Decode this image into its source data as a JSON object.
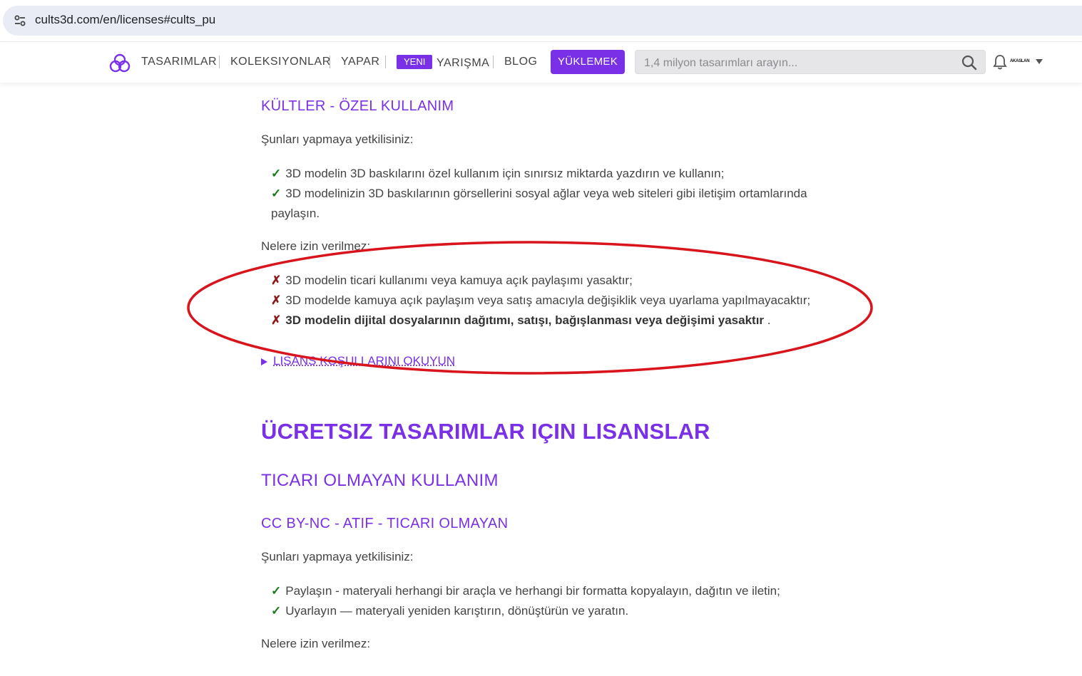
{
  "browser": {
    "url": "cults3d.com/en/licenses#cults_pu",
    "site_info_icon": "tune-icon"
  },
  "header": {
    "nav": [
      "TASARIMLAR",
      "KOLEKSIYONLAR",
      "YAPAR",
      "YARIŞMA",
      "BLOG"
    ],
    "new_badge": "YENI",
    "upload_label": "YÜKLEMEK",
    "search_placeholder": "1,4 milyon tasarımları arayın...",
    "avatar_text": "AKASLAN"
  },
  "content": {
    "section1": {
      "title": "KÜLTLER - ÖZEL KULLANIM",
      "allowed_intro": "Şunları yapmaya yetkilisiniz:",
      "allowed": [
        "3D modelin 3D baskılarını özel kullanım için sınırsız miktarda yazdırın ve kullanın;",
        "3D modelinizin 3D baskılarının görsellerini sosyal ağlar veya web siteleri gibi iletişim ortamlarında paylaşın."
      ],
      "forbidden_intro": "Nelere izin verilmez:",
      "forbidden": [
        "3D modelin ticari kullanımı veya kamuya açık paylaşımı yasaktır;",
        "3D modelde kamuya açık paylaşım veya satış amacıyla değişiklik veya uyarlama yapılmayacaktır;",
        "3D modelin dijital dosyalarının dağıtımı, satışı, bağışlanması veya değişimi yasaktır"
      ],
      "forbidden_tail": ".",
      "read_terms": "LISANS KOŞULLARINI OKUYUN"
    },
    "free_title": "ÜCRETSIZ TASARIMLAR IÇIN LISANSLAR",
    "noncommercial_title": "TICARI OLMAYAN KULLANIM",
    "section2": {
      "title": "CC BY-NC - ATIF - TICARI OLMAYAN",
      "allowed_intro": "Şunları yapmaya yetkilisiniz:",
      "allowed": [
        "Paylaşın - materyali herhangi bir araçla ve herhangi bir formatta kopyalayın, dağıtın ve iletin;",
        "Uyarlayın — materyali yeniden karıştırın, dönüştürün ve yaratın."
      ],
      "forbidden_intro": "Nelere izin verilmez:"
    },
    "marks": {
      "check": "✓",
      "cross": "✗"
    }
  },
  "colors": {
    "accent": "#7a30e6",
    "check": "#1c7a1c",
    "cross": "#8b1a1a",
    "annotation": "#d8141c"
  }
}
